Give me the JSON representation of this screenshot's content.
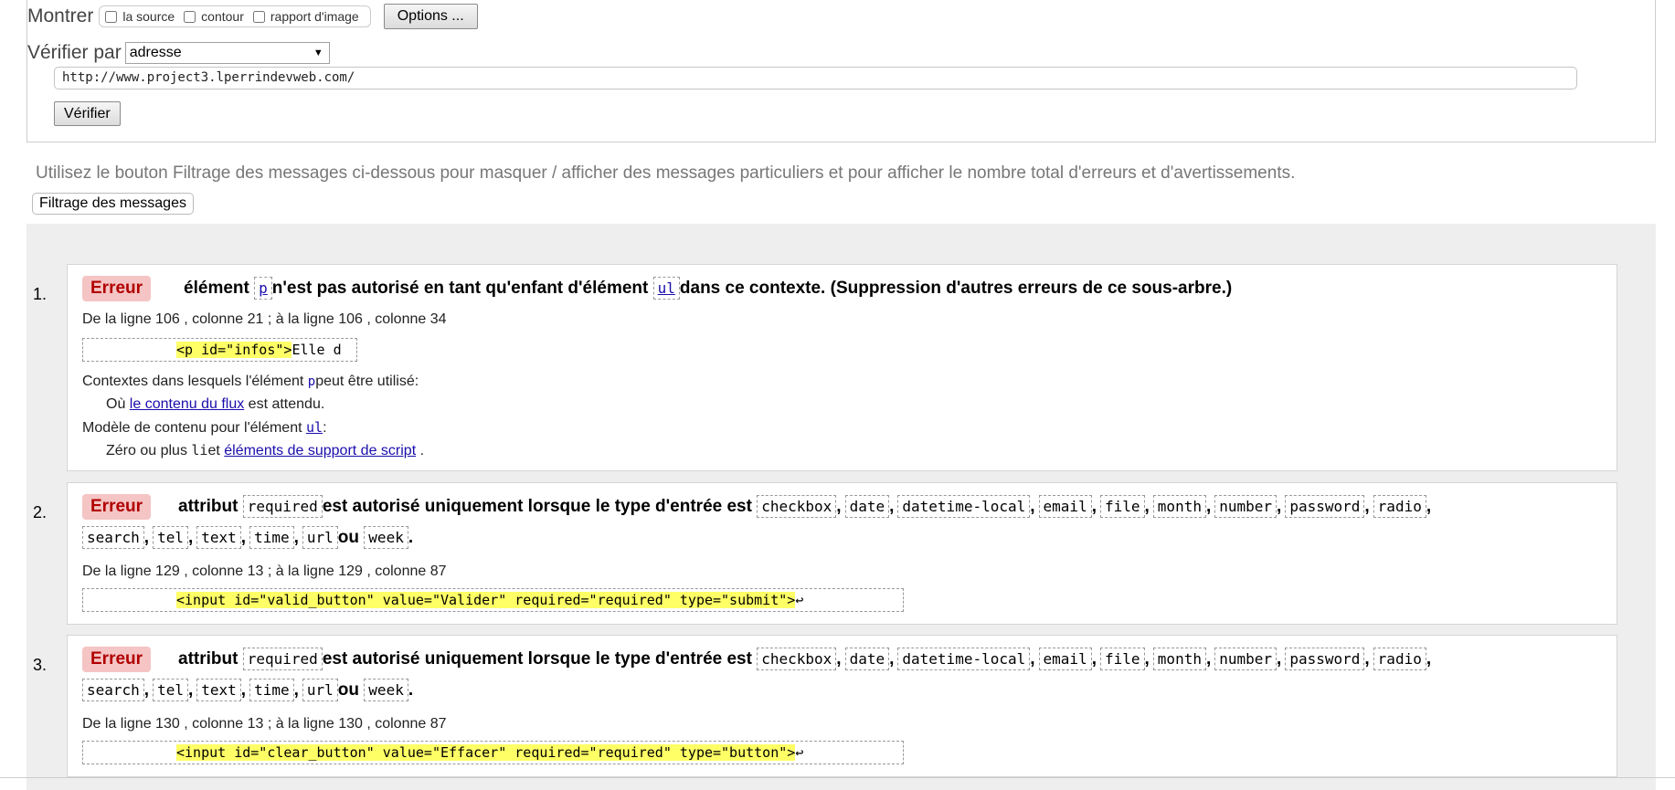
{
  "form": {
    "show_label": "Montrer",
    "opt_source": "la source",
    "opt_outline": "contour",
    "opt_image": "rapport d'image",
    "options_button": "Options ...",
    "check_by_label": "Vérifier par",
    "check_by_value": "adresse",
    "url_value": "http://www.project3.lperrindevweb.com/",
    "verify_button": "Vérifier"
  },
  "hint": "Utilisez le bouton Filtrage des messages ci-dessous pour masquer / afficher des messages particuliers et pour afficher le nombre total d'erreurs et d'avertissements.",
  "filter_button": "Filtrage des messages",
  "messages": [
    {
      "num": "1.",
      "badge": "Erreur",
      "t1": "élément",
      "c1": "p",
      "t2": "n'est pas autorisé en tant qu'enfant d'élément",
      "c2": "ul",
      "t3": "dans ce contexte. (Suppression d'autres erreurs de ce sous-arbre.)",
      "lines": "De la ligne 106 , colonne 21 ; à la ligne 106 , colonne 34",
      "extract_hl": "<p id=\"infos\">",
      "extract_rest": "Elle d",
      "ctx_a": "Contextes dans lesquels l'élément",
      "ctx_b": "p",
      "ctx_c": "peut être utilisé:",
      "where_a": "Où",
      "where_link": "le contenu du flux",
      "where_c": "est attendu.",
      "model_a": "Modèle de contenu pour l'élément",
      "model_b": "ul",
      "model_c": ":",
      "zero_a": "Zéro ou plus",
      "zero_code": "li",
      "zero_b": "et",
      "zero_link": "éléments de support de script",
      "zero_c": "."
    },
    {
      "num": "2.",
      "badge": "Erreur",
      "lines": "De la ligne 129 , colonne 13 ; à la ligne 129 , colonne 87",
      "extract_hl": "<input id=\"valid_button\" value=\"Valider\" required=\"required\" type=\"submit\">",
      "extract_rest": "↩"
    },
    {
      "num": "3.",
      "badge": "Erreur",
      "lines": "De la ligne 130 , colonne 13 ; à la ligne 130 , colonne 87",
      "extract_hl": "<input id=\"clear_button\" value=\"Effacer\" required=\"required\" type=\"button\">",
      "extract_rest": "↩"
    }
  ],
  "attr_msg": {
    "t1": "attribut",
    "attr": "required",
    "t2": "est autorisé uniquement lorsque le type d'entrée est",
    "types1": [
      "checkbox",
      "date",
      "datetime-local",
      "email",
      "file",
      "month",
      "number",
      "password",
      "radio"
    ],
    "types2": [
      "search",
      "tel",
      "text",
      "time",
      "url"
    ],
    "or": "ou",
    "last": "week",
    "comma": ",",
    "period": "."
  }
}
